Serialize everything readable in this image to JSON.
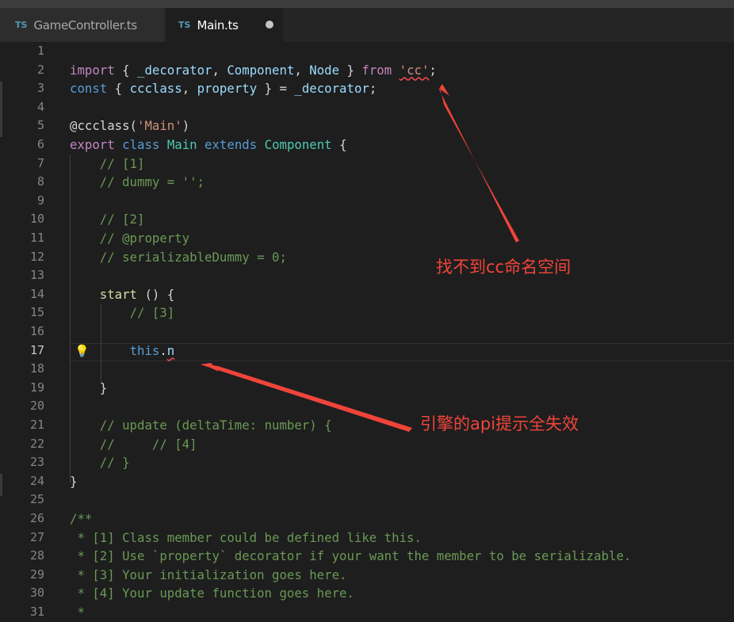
{
  "tabs": [
    {
      "icon": "TS",
      "label": "GameController.ts",
      "active": false
    },
    {
      "icon": "TS",
      "label": "Main.ts",
      "active": true,
      "dirty": true
    }
  ],
  "editor": {
    "current_line": 17,
    "lines": [
      {
        "n": 1,
        "tokens": []
      },
      {
        "n": 2,
        "tokens": [
          [
            "import",
            "ctl"
          ],
          [
            " { ",
            ""
          ],
          [
            "_decorator",
            "var"
          ],
          [
            ", ",
            ""
          ],
          [
            "Component",
            "var"
          ],
          [
            ", ",
            ""
          ],
          [
            "Node",
            "var"
          ],
          [
            " } ",
            ""
          ],
          [
            "from",
            "ctl"
          ],
          [
            " ",
            ""
          ],
          [
            "'cc'",
            "str squig"
          ],
          [
            ";",
            ""
          ]
        ]
      },
      {
        "n": 3,
        "tokens": [
          [
            "const",
            "kw"
          ],
          [
            " { ",
            ""
          ],
          [
            "ccclass",
            "var"
          ],
          [
            ", ",
            ""
          ],
          [
            "property",
            "var"
          ],
          [
            " } = ",
            ""
          ],
          [
            "_decorator",
            "var"
          ],
          [
            ";",
            ""
          ]
        ]
      },
      {
        "n": 4,
        "tokens": []
      },
      {
        "n": 5,
        "tokens": [
          [
            "@ccclass(",
            ""
          ],
          [
            "'Main'",
            "str"
          ],
          [
            ")",
            ""
          ]
        ]
      },
      {
        "n": 6,
        "tokens": [
          [
            "export",
            "ctl"
          ],
          [
            " ",
            ""
          ],
          [
            "class",
            "kw"
          ],
          [
            " ",
            ""
          ],
          [
            "Main",
            "cls"
          ],
          [
            " ",
            ""
          ],
          [
            "extends",
            "kw"
          ],
          [
            " ",
            ""
          ],
          [
            "Component",
            "cls"
          ],
          [
            " {",
            ""
          ]
        ]
      },
      {
        "n": 7,
        "tokens": [
          [
            "    ",
            ""
          ],
          [
            "// [1]",
            "cmt"
          ]
        ]
      },
      {
        "n": 8,
        "tokens": [
          [
            "    ",
            ""
          ],
          [
            "// dummy = '';",
            "cmt"
          ]
        ]
      },
      {
        "n": 9,
        "tokens": []
      },
      {
        "n": 10,
        "tokens": [
          [
            "    ",
            ""
          ],
          [
            "// [2]",
            "cmt"
          ]
        ]
      },
      {
        "n": 11,
        "tokens": [
          [
            "    ",
            ""
          ],
          [
            "// @property",
            "cmt"
          ]
        ]
      },
      {
        "n": 12,
        "tokens": [
          [
            "    ",
            ""
          ],
          [
            "// serializableDummy = 0;",
            "cmt"
          ]
        ]
      },
      {
        "n": 13,
        "tokens": []
      },
      {
        "n": 14,
        "tokens": [
          [
            "    ",
            ""
          ],
          [
            "start",
            "fn"
          ],
          [
            " () {",
            ""
          ]
        ]
      },
      {
        "n": 15,
        "tokens": [
          [
            "        ",
            ""
          ],
          [
            "// [3]",
            "cmt"
          ]
        ]
      },
      {
        "n": 16,
        "tokens": []
      },
      {
        "n": 17,
        "tokens": [
          [
            "        ",
            ""
          ],
          [
            "this",
            "kw"
          ],
          [
            ".",
            ""
          ],
          [
            "n",
            "var squig"
          ]
        ]
      },
      {
        "n": 18,
        "tokens": []
      },
      {
        "n": 19,
        "tokens": [
          [
            "    }",
            ""
          ]
        ]
      },
      {
        "n": 20,
        "tokens": []
      },
      {
        "n": 21,
        "tokens": [
          [
            "    ",
            ""
          ],
          [
            "// update (deltaTime: number) {",
            "cmt"
          ]
        ]
      },
      {
        "n": 22,
        "tokens": [
          [
            "    ",
            ""
          ],
          [
            "//     // [4]",
            "cmt"
          ]
        ]
      },
      {
        "n": 23,
        "tokens": [
          [
            "    ",
            ""
          ],
          [
            "// }",
            "cmt"
          ]
        ]
      },
      {
        "n": 24,
        "tokens": [
          [
            "}",
            ""
          ]
        ]
      },
      {
        "n": 25,
        "tokens": []
      },
      {
        "n": 26,
        "tokens": [
          [
            "/**",
            "cmt"
          ]
        ]
      },
      {
        "n": 27,
        "tokens": [
          [
            " * [1] Class member could be defined like this.",
            "cmt"
          ]
        ]
      },
      {
        "n": 28,
        "tokens": [
          [
            " * [2] Use `property` decorator if your want the member to be serializable.",
            "cmt"
          ]
        ]
      },
      {
        "n": 29,
        "tokens": [
          [
            " * [3] Your initialization goes here.",
            "cmt"
          ]
        ]
      },
      {
        "n": 30,
        "tokens": [
          [
            " * [4] Your update function goes here.",
            "cmt"
          ]
        ]
      },
      {
        "n": 31,
        "tokens": [
          [
            " *",
            "cmt"
          ]
        ]
      }
    ]
  },
  "annotations": {
    "namespace_error": "找不到cc命名空间",
    "api_hint_error": "引擎的api提示全失效"
  },
  "colors": {
    "annotation": "#f0443a",
    "background": "#1e1e1e",
    "keyword": "#569cd6",
    "control": "#c586c0",
    "string": "#ce9178",
    "comment": "#6a9955",
    "variable": "#9cdcfe",
    "class": "#4ec9b0",
    "function": "#dcdcaa"
  },
  "icons": {
    "lightbulb": "lightbulb-icon",
    "dirty": "unsaved-dot-icon"
  }
}
